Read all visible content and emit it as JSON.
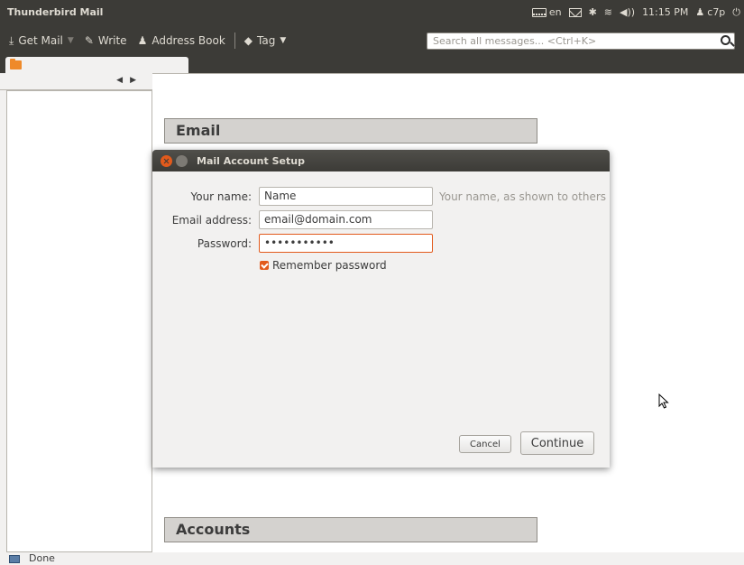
{
  "app_title": "Thunderbird Mail",
  "indicators": {
    "keyboard_layout": "en",
    "time": "11:15 PM",
    "user": "c7p"
  },
  "toolbar": {
    "get_mail_label": "Get Mail",
    "write_label": "Write",
    "address_book_label": "Address Book",
    "tag_label": "Tag"
  },
  "search": {
    "placeholder": "Search all messages... <Ctrl+K>"
  },
  "main": {
    "email_section": "Email",
    "accounts_section": "Accounts"
  },
  "dialog": {
    "title": "Mail Account Setup",
    "name_label": "Your name:",
    "name_value": "Name",
    "name_hint": "Your name, as shown to others",
    "email_label": "Email address:",
    "email_value": "email@domain.com",
    "password_label": "Password:",
    "password_value": "•••••••••••",
    "remember_label": "Remember password",
    "remember_checked": true,
    "cancel_label": "Cancel",
    "continue_label": "Continue"
  },
  "statusbar": {
    "text": "Done"
  },
  "colors": {
    "panel": "#3c3b37",
    "accent": "#e25a1c"
  }
}
